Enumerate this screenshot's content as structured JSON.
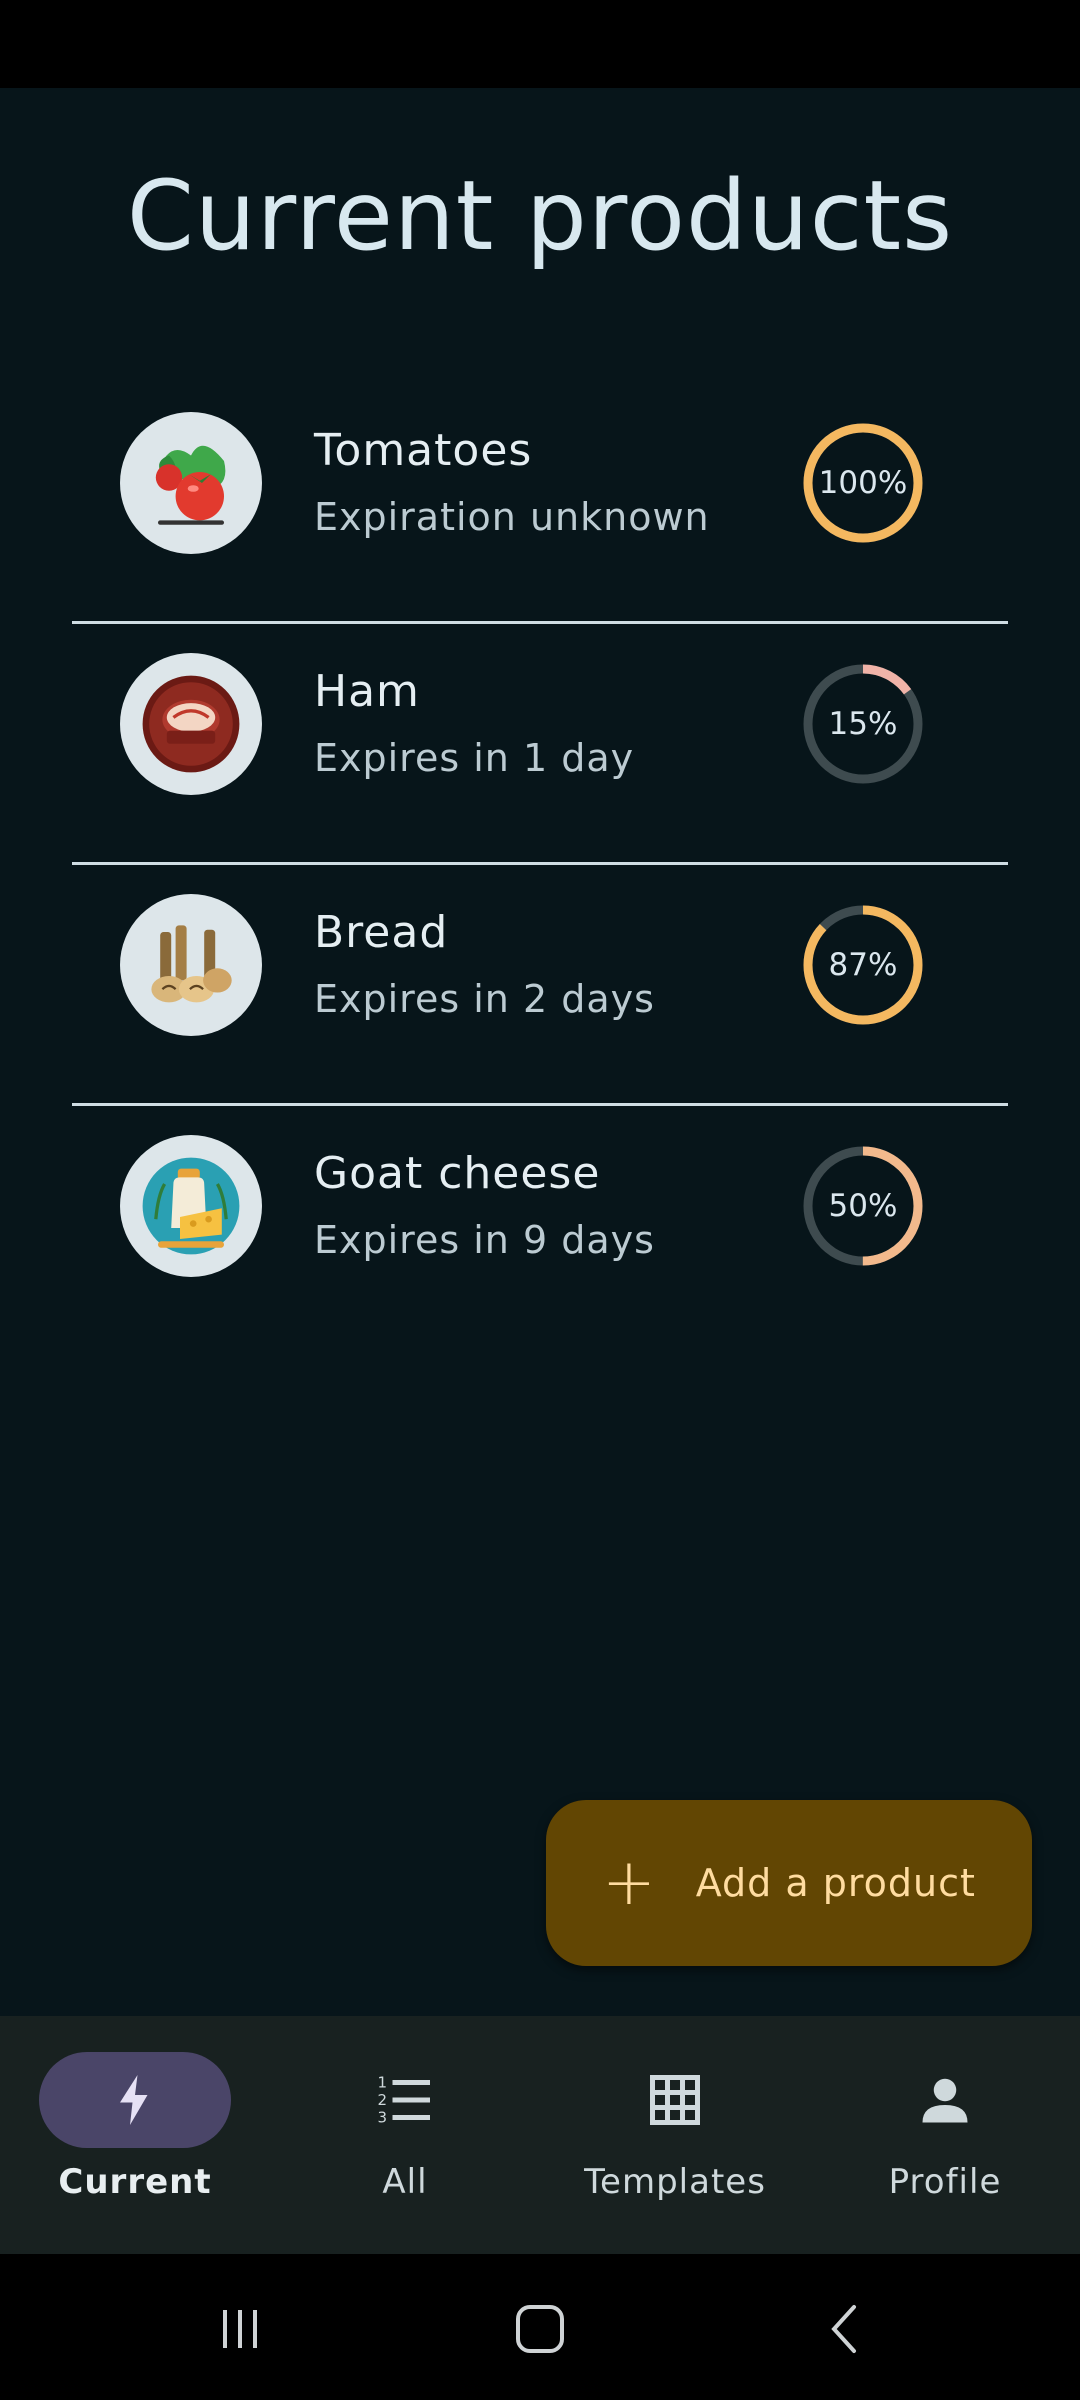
{
  "page": {
    "title": "Current products"
  },
  "products": [
    {
      "name": "Tomatoes",
      "subtitle": "Expiration unknown",
      "percent_label": "100%",
      "percent": 100,
      "ring_color": "#f4b860",
      "icon": "tomato-icon"
    },
    {
      "name": "Ham",
      "subtitle": "Expires in 1 day",
      "percent_label": "15%",
      "percent": 15,
      "ring_color": "#f0b3a8",
      "icon": "ham-icon"
    },
    {
      "name": "Bread",
      "subtitle": "Expires in 2 days",
      "percent_label": "87%",
      "percent": 87,
      "ring_color": "#f4b860",
      "icon": "bread-icon"
    },
    {
      "name": "Goat cheese",
      "subtitle": "Expires in 9 days",
      "percent_label": "50%",
      "percent": 50,
      "ring_color": "#f2b98c",
      "icon": "cheese-icon"
    }
  ],
  "fab": {
    "label": "Add a product"
  },
  "nav": {
    "items": [
      {
        "label": "Current",
        "icon": "bolt-icon",
        "active": true
      },
      {
        "label": "All",
        "icon": "numbered-list-icon",
        "active": false
      },
      {
        "label": "Templates",
        "icon": "grid-icon",
        "active": false
      },
      {
        "label": "Profile",
        "icon": "person-icon",
        "active": false
      }
    ]
  },
  "colors": {
    "background": "#07151a",
    "accent": "#624603",
    "nav_active": "#4a4568",
    "ring_track": "#3e4b4f"
  }
}
